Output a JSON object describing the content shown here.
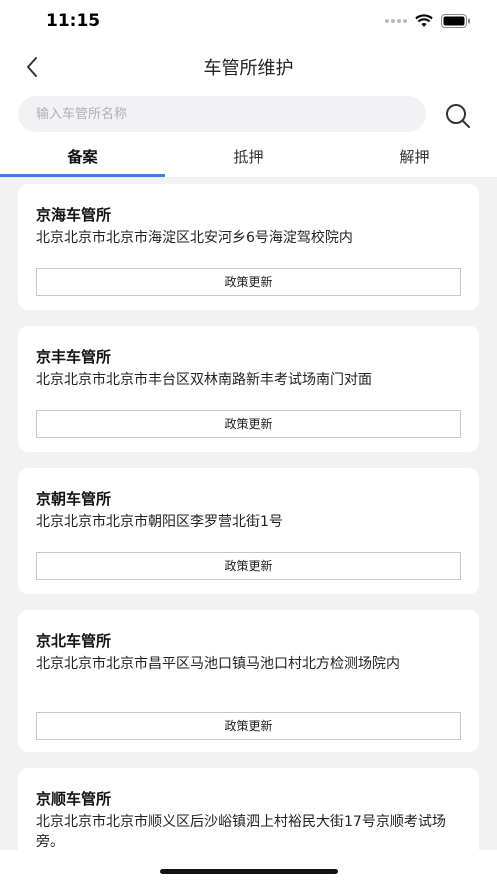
{
  "status_bar": {
    "time": "11:15"
  },
  "header": {
    "title": "车管所维护"
  },
  "search": {
    "placeholder": "输入车管所名称"
  },
  "tabs": [
    {
      "label": "备案",
      "active": true
    },
    {
      "label": "抵押",
      "active": false
    },
    {
      "label": "解押",
      "active": false
    }
  ],
  "accent_color": "#3d7ee6",
  "items": [
    {
      "name": "京海车管所",
      "address": "北京北京市北京市海淀区北安河乡6号海淀驾校院内",
      "button": "政策更新"
    },
    {
      "name": "京丰车管所",
      "address": "北京北京市北京市丰台区双林南路新丰考试场南门对面",
      "button": "政策更新"
    },
    {
      "name": "京朝车管所",
      "address": "北京北京市北京市朝阳区李罗营北街1号",
      "button": "政策更新"
    },
    {
      "name": "京北车管所",
      "address": "北京北京市北京市昌平区马池口镇马池口村北方检测场院内",
      "button": "政策更新"
    },
    {
      "name": "京顺车管所",
      "address": "北京北京市北京市顺义区后沙峪镇泗上村裕民大街17号京顺考试场旁。"
    }
  ]
}
